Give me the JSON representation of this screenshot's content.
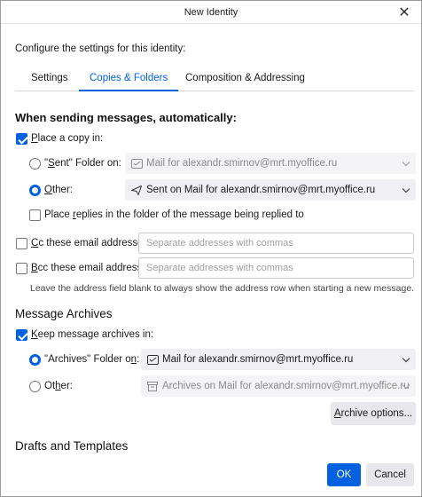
{
  "window": {
    "title": "New Identity",
    "close_glyph": "✕"
  },
  "intro": "Configure the settings for this identity:",
  "tabs": [
    {
      "label": "Settings",
      "active": false
    },
    {
      "label": "Copies & Folders",
      "active": true
    },
    {
      "label": "Composition & Addressing",
      "active": false
    }
  ],
  "sending": {
    "heading": "When sending messages, automatically:",
    "place_copy": {
      "pre": "",
      "u": "P",
      "post": "lace a copy in:",
      "checked": true
    },
    "sent_folder": {
      "pre": "\"",
      "u": "S",
      "post": "ent\" Folder on:",
      "checked": false
    },
    "sent_folder_dropdown": "Mail for alexandr.smirnov@mrt.myoffice.ru",
    "other": {
      "pre": "",
      "u": "O",
      "post": "ther:",
      "checked": true
    },
    "other_dropdown": "Sent on Mail for alexandr.smirnov@mrt.myoffice.ru",
    "place_replies": {
      "pre": "Place ",
      "u": "r",
      "post": "eplies in the folder of the message being replied to",
      "checked": false
    },
    "cc": {
      "pre": "",
      "u": "C",
      "post": "c these email addresses:",
      "checked": false
    },
    "cc_placeholder": "Separate addresses with commas",
    "bcc": {
      "pre": "",
      "u": "B",
      "post": "cc these email addresses:",
      "checked": false
    },
    "bcc_placeholder": "Separate addresses with commas",
    "hint": "Leave the address field blank to always show the address row when starting a new message."
  },
  "archives": {
    "heading": "Message Archives",
    "keep": {
      "pre": "",
      "u": "K",
      "post": "eep message archives in:",
      "checked": true
    },
    "archives_folder": {
      "pre": "\"Archives\" Folder o",
      "u": "n",
      "post": ":",
      "checked": true
    },
    "archives_folder_dropdown": "Mail for alexandr.smirnov@mrt.myoffice.ru",
    "other": {
      "pre": "Ot",
      "u": "h",
      "post": "er:",
      "checked": false
    },
    "other_dropdown": "Archives on Mail for alexandr.smirnov@mrt.myoffice.ru",
    "options_button": {
      "pre": "",
      "u": "A",
      "post": "rchive options..."
    }
  },
  "drafts": {
    "heading": "Drafts and Templates"
  },
  "footer": {
    "ok": "OK",
    "cancel": "Cancel"
  },
  "colors": {
    "accent": "#0061e0"
  }
}
